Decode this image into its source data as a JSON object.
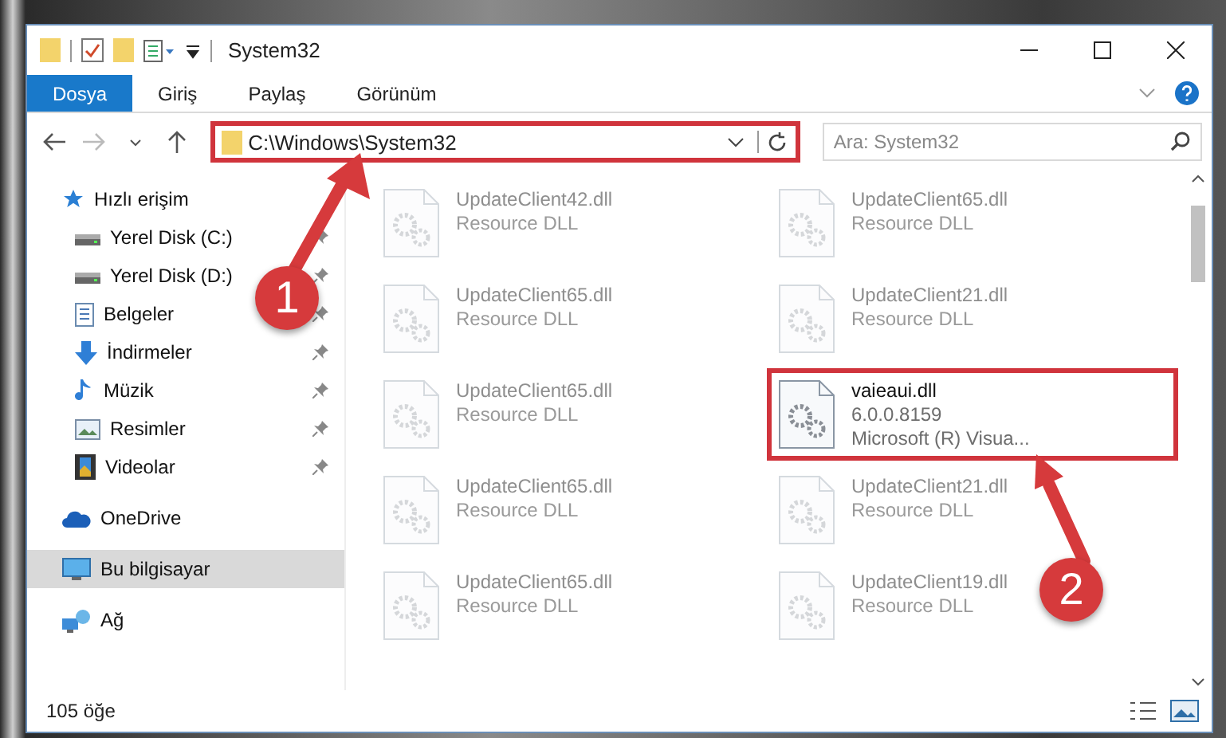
{
  "window": {
    "title": "System32"
  },
  "ribbon_tabs": [
    {
      "label": "Dosya",
      "selected": true
    },
    {
      "label": "Giriş",
      "selected": false
    },
    {
      "label": "Paylaş",
      "selected": false
    },
    {
      "label": "Görünüm",
      "selected": false
    }
  ],
  "address_bar": {
    "path": "C:\\Windows\\System32",
    "highlighted": true
  },
  "search": {
    "placeholder": "Ara: System32"
  },
  "sidebar": {
    "items": [
      {
        "label": "Hızlı erişim",
        "kind": "star",
        "selected": false,
        "children": [
          {
            "label": "Yerel Disk (C:)",
            "kind": "drive",
            "selected": false,
            "pinned": true
          },
          {
            "label": "Yerel Disk (D:)",
            "kind": "drive",
            "selected": false,
            "pinned": true
          },
          {
            "label": "Belgeler",
            "kind": "documents",
            "selected": false,
            "pinned": true
          },
          {
            "label": "İndirmeler",
            "kind": "downloads",
            "selected": false,
            "pinned": true
          },
          {
            "label": "Müzik",
            "kind": "music",
            "selected": false,
            "pinned": true
          },
          {
            "label": "Resimler",
            "kind": "pictures",
            "selected": false,
            "pinned": true
          },
          {
            "label": "Videolar",
            "kind": "videos",
            "selected": false,
            "pinned": true
          }
        ]
      },
      {
        "label": "OneDrive",
        "kind": "cloud",
        "selected": false
      },
      {
        "label": "Bu bilgisayar",
        "kind": "computer",
        "selected": true
      },
      {
        "label": "Ağ",
        "kind": "network",
        "selected": false
      }
    ]
  },
  "files": [
    {
      "name": "UpdateClient42.dll",
      "details": [
        "Resource DLL"
      ],
      "dimmed": true,
      "highlighted": false
    },
    {
      "name": "UpdateClient65.dll",
      "details": [
        "Resource DLL"
      ],
      "dimmed": true,
      "highlighted": false
    },
    {
      "name": "UpdateClient65.dll",
      "details": [
        "Resource DLL"
      ],
      "dimmed": true,
      "highlighted": false
    },
    {
      "name": "UpdateClient21.dll",
      "details": [
        "Resource DLL"
      ],
      "dimmed": true,
      "highlighted": false
    },
    {
      "name": "UpdateClient65.dll",
      "details": [
        "Resource DLL"
      ],
      "dimmed": true,
      "highlighted": false
    },
    {
      "name": "vaieaui.dll",
      "details": [
        "6.0.0.8159",
        "Microsoft (R) Visua..."
      ],
      "dimmed": false,
      "highlighted": true
    },
    {
      "name": "UpdateClient65.dll",
      "details": [
        "Resource DLL"
      ],
      "dimmed": true,
      "highlighted": false
    },
    {
      "name": "UpdateClient21.dll",
      "details": [
        "Resource DLL"
      ],
      "dimmed": true,
      "highlighted": false
    },
    {
      "name": "UpdateClient65.dll",
      "details": [
        "Resource DLL"
      ],
      "dimmed": true,
      "highlighted": false
    },
    {
      "name": "UpdateClient19.dll",
      "details": [
        "Resource DLL"
      ],
      "dimmed": true,
      "highlighted": false
    }
  ],
  "status_bar": {
    "count": "105 öğe"
  },
  "annotations": [
    {
      "label": "1"
    },
    {
      "label": "2"
    }
  ]
}
